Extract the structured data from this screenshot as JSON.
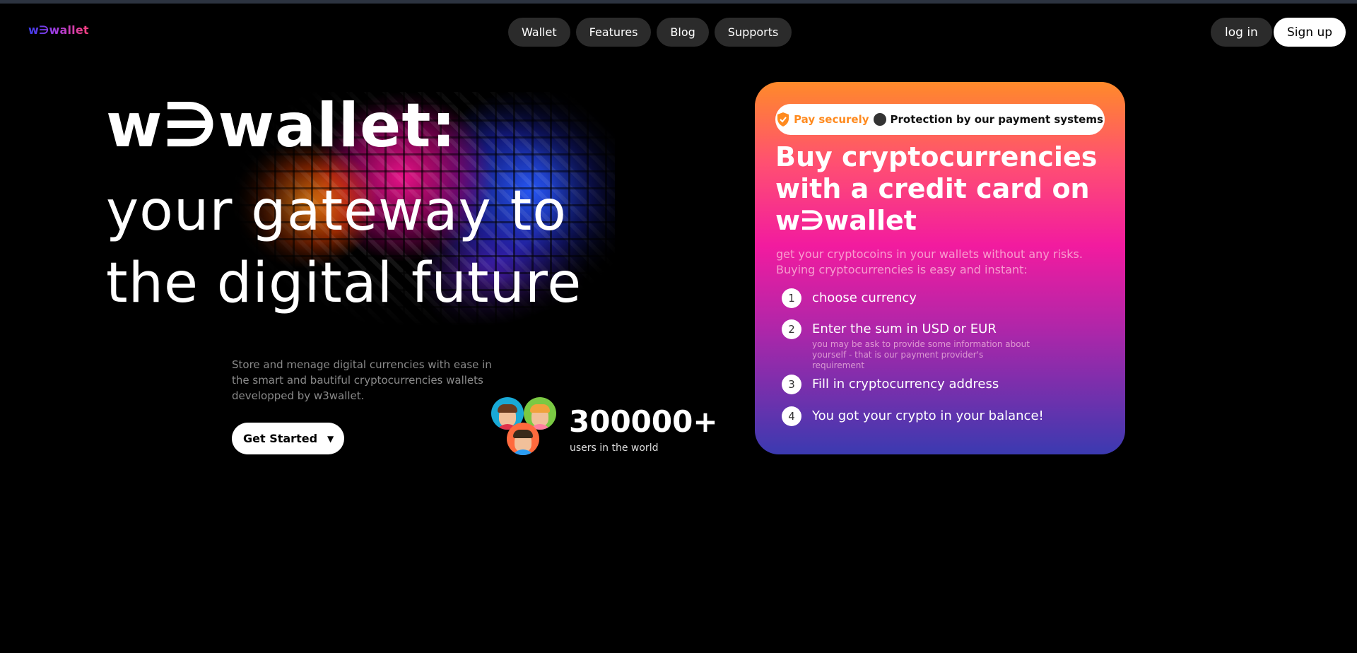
{
  "header": {
    "logo": "w∋wallet",
    "nav": [
      "Wallet",
      "Features",
      "Blog",
      "Supports"
    ],
    "login_label": "log in",
    "signup_label": "Sign up"
  },
  "hero": {
    "title_line1": "w∋wallet:",
    "title_line2": "your gateway to",
    "title_line3": "the digital future",
    "description": "Store and menage digital currencies with ease in the smart and bautiful cryptocurrencies wallets developped by w3wallet.",
    "cta_label": "Get Started",
    "cta_icon": "caret-down-icon",
    "users_count": "300000+",
    "users_label": "users in the world"
  },
  "card": {
    "pay_secure": "Pay securely",
    "protection": "Protection by our payment systems",
    "title": "Buy cryptocurrencies with a credit card on w∋wallet",
    "subtitle": "get your cryptocoins in your wallets without any risks. Buying cryptocurrencies is easy and instant:",
    "steps": [
      {
        "num": "1",
        "text": "choose currency",
        "note": ""
      },
      {
        "num": "2",
        "text": "Enter the sum in USD or EUR",
        "note": "you may be ask to provide some information about yourself - that is our payment provider's requirement"
      },
      {
        "num": "3",
        "text": "Fill in cryptocurrency address",
        "note": ""
      },
      {
        "num": "4",
        "text": "You got your crypto in your balance!",
        "note": ""
      }
    ],
    "colors": {
      "top": "#ff8a2a",
      "middle": "#f21b9f",
      "bottom": "#3b3ab0"
    }
  }
}
